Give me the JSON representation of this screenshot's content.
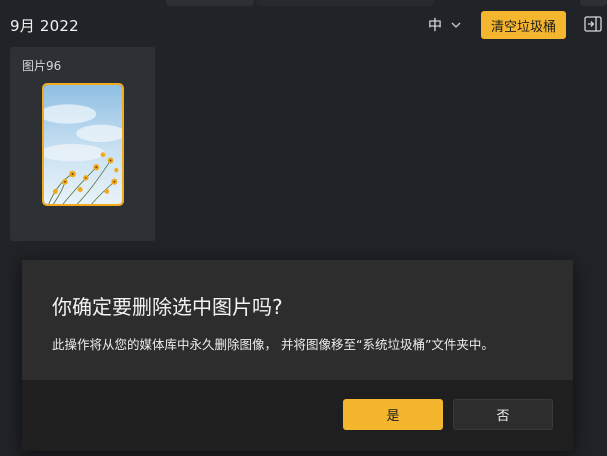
{
  "header": {
    "date_heading": "9月 2022",
    "size_select": {
      "selected": "中"
    },
    "empty_trash_label": "清空垃圾桶"
  },
  "photos": [
    {
      "title": "图片96",
      "selected": true
    }
  ],
  "dialog": {
    "title": "你确定要删除选中图片吗?",
    "message": "此操作将从您的媒体库中永久删除图像， 并将图像移至“系统垃圾桶”文件夹中。",
    "yes_label": "是",
    "no_label": "否"
  },
  "colors": {
    "accent": "#f5b62f",
    "background": "#202327",
    "card": "#2d3035",
    "dialog_body": "#2d2d2d",
    "dialog_footer": "#1f1f1f"
  },
  "icons": {
    "size_select": "chevron-down-icon",
    "sidebar_toggle": "panel-collapse-icon"
  }
}
